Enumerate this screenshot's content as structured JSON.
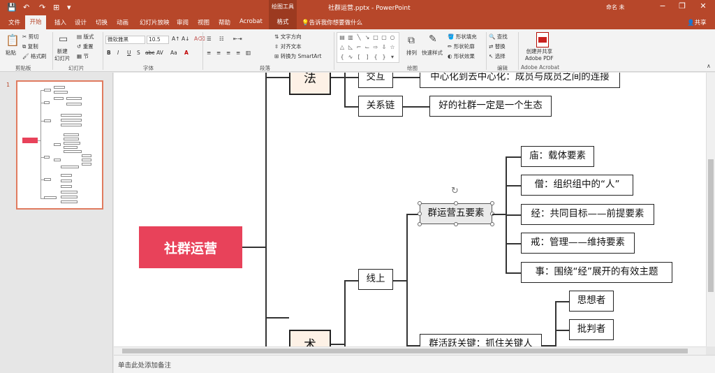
{
  "titlebar": {
    "context_tools": "绘图工具",
    "doc_title": "社群运营.pptx - PowerPoint",
    "user": "命名 未",
    "min": "−",
    "restore": "❐",
    "close": "✕",
    "quick_access": [
      "💾",
      "↶",
      "↷",
      "⊞",
      "▾"
    ]
  },
  "tabs": [
    "文件",
    "开始",
    "插入",
    "设计",
    "切换",
    "动画",
    "幻灯片放映",
    "审阅",
    "视图",
    "帮助",
    "Acrobat",
    "格式"
  ],
  "tellme": "告诉我你想要做什么",
  "share": "共享",
  "ribbon": {
    "clipboard": {
      "paste": "粘贴",
      "cut": "剪切",
      "copy": "复制",
      "painter": "格式刷",
      "label": "剪贴板"
    },
    "slides": {
      "new_slide": "新建\n幻灯片",
      "layout": "版式",
      "reset": "重置",
      "section": "节",
      "label": "幻灯片"
    },
    "font": {
      "name": "微软雅黑",
      "size": "10.5",
      "label": "字体"
    },
    "paragraph": {
      "text_dir": "文字方向",
      "align_text": "对齐文本",
      "smartart": "转换为 SmartArt",
      "label": "段落"
    },
    "drawing": {
      "arrange": "排列",
      "quick_styles": "快速样式",
      "fill": "形状填充",
      "outline": "形状轮廓",
      "effects": "形状效果",
      "label": "绘图"
    },
    "editing": {
      "find": "查找",
      "replace": "替换",
      "select": "选择",
      "label": "编辑"
    },
    "acrobat": {
      "create": "创建并共享\nAdobe PDF",
      "label": "Adobe Acrobat"
    }
  },
  "thumbnail": {
    "number": "1"
  },
  "notes": "单击此处添加备注",
  "mindmap": {
    "root": "社群运营",
    "fa": "法",
    "shu": "术",
    "jiaohu": "交互",
    "jiaohu_desc": "中心化到去中心化：成员与成员之间的连接",
    "guanxi": "关系链",
    "guanxi_desc": "好的社群一定是一个生态",
    "xianshang": "线上",
    "five": "群运营五要素",
    "miao": "庙：载体要素",
    "seng": "僧：组织组中的“人”",
    "jing": "经：共同目标——前提要素",
    "jie": "戒：管理——维持要素",
    "shi": "事：围绕“经”展开的有效主题",
    "huoyue": "群活跃关键：抓住关键人",
    "sixiang": "思想者",
    "pipan": "批判者"
  },
  "colors": {
    "brand": "#b7472a",
    "root_fill": "#e8425a",
    "fa_fill": "#fdf1e6"
  }
}
